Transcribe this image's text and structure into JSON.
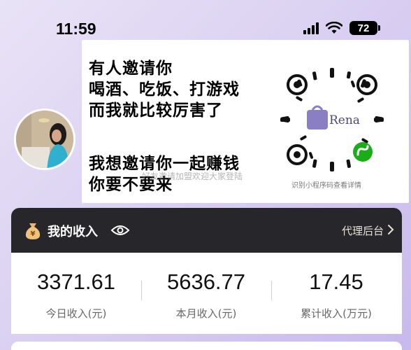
{
  "status_bar": {
    "time": "11:59",
    "battery": "72"
  },
  "ad": {
    "lines_top": [
      "有人邀请你",
      "喝酒、吃饭、打游戏",
      "而我就比较厉害了"
    ],
    "lines_bottom": [
      "我想邀请你一起赚钱",
      "你要不要来"
    ],
    "qr_brand": "Rena",
    "qr_caption": "识别小程序码查看详情",
    "watermark": "好友邀请加盟欢迎大家登陆"
  },
  "income": {
    "title": "我的收入",
    "agent_link": "代理后台",
    "stats": [
      {
        "value": "3371.61",
        "label": "今日收入(元)"
      },
      {
        "value": "5636.77",
        "label": "本月收入(元)"
      },
      {
        "value": "17.45",
        "label": "累计收入(万元)"
      }
    ]
  },
  "colors": {
    "header_bg": "#27262b",
    "background": "#d8cdf1",
    "qr_green": "#1aad19"
  }
}
